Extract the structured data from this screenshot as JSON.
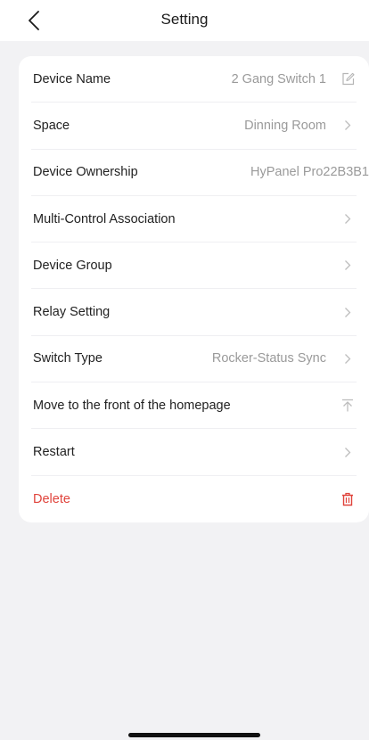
{
  "header": {
    "title": "Setting",
    "back_icon": "chevron-left-icon"
  },
  "settings": {
    "device_name": {
      "label": "Device Name",
      "value": "2 Gang Switch 1",
      "icon": "edit-icon"
    },
    "space": {
      "label": "Space",
      "value": "Dinning Room",
      "icon": "chevron-right-icon"
    },
    "ownership": {
      "label": "Device Ownership",
      "value": "HyPanel Pro22B3B1"
    },
    "multi_control": {
      "label": "Multi-Control Association",
      "icon": "chevron-right-icon"
    },
    "device_group": {
      "label": "Device Group",
      "icon": "chevron-right-icon"
    },
    "relay_setting": {
      "label": "Relay Setting",
      "icon": "chevron-right-icon"
    },
    "switch_type": {
      "label": "Switch Type",
      "value": "Rocker-Status Sync",
      "icon": "chevron-right-icon"
    },
    "move_front": {
      "label": "Move to the front of the homepage",
      "icon": "pin-to-top-icon"
    },
    "restart": {
      "label": "Restart",
      "icon": "chevron-right-icon"
    },
    "delete": {
      "label": "Delete",
      "icon": "trash-icon"
    }
  },
  "colors": {
    "danger": "#e0443c",
    "secondary_text": "#9a9a9a",
    "background": "#f2f2f4"
  }
}
